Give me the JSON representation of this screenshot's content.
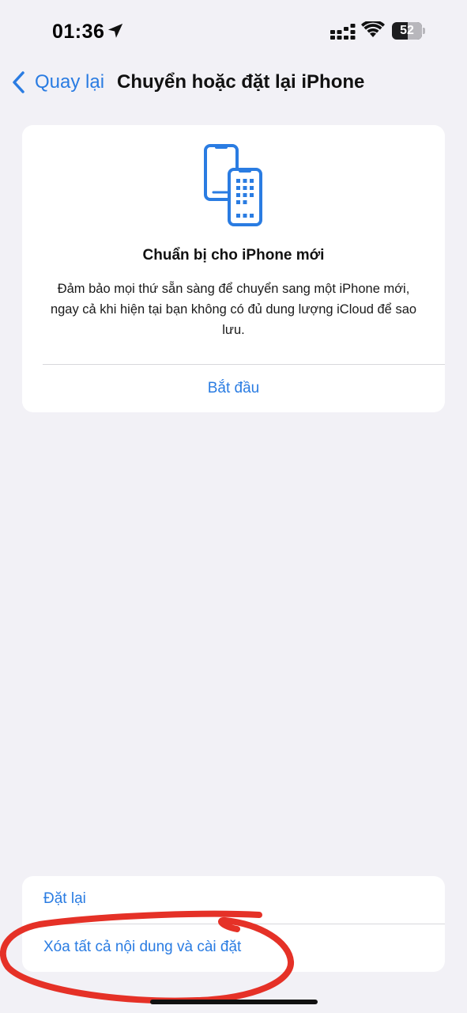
{
  "status_bar": {
    "time": "01:36",
    "battery_percent": "52",
    "battery_level": 0.52,
    "icons": [
      "location-arrow-icon",
      "cellular-signal-icon",
      "wifi-icon",
      "battery-icon"
    ]
  },
  "nav": {
    "back_label": "Quay lại",
    "title": "Chuyển hoặc đặt lại iPhone"
  },
  "transfer_card": {
    "icon": "two-iphones-icon",
    "title": "Chuẩn bị cho iPhone mới",
    "description": "Đảm bảo mọi thứ sẵn sàng để chuyển sang một iPhone mới, ngay cả khi hiện tại bạn không có đủ dung lượng iCloud để sao lưu.",
    "action_label": "Bắt đầu"
  },
  "reset_list": {
    "items": [
      {
        "label": "Đặt lại"
      },
      {
        "label": "Xóa tất cả nội dung và cài đặt"
      }
    ]
  },
  "colors": {
    "accent": "#2a7ce2",
    "background": "#f2f1f6",
    "card": "#ffffff",
    "annotation": "#e53127"
  }
}
